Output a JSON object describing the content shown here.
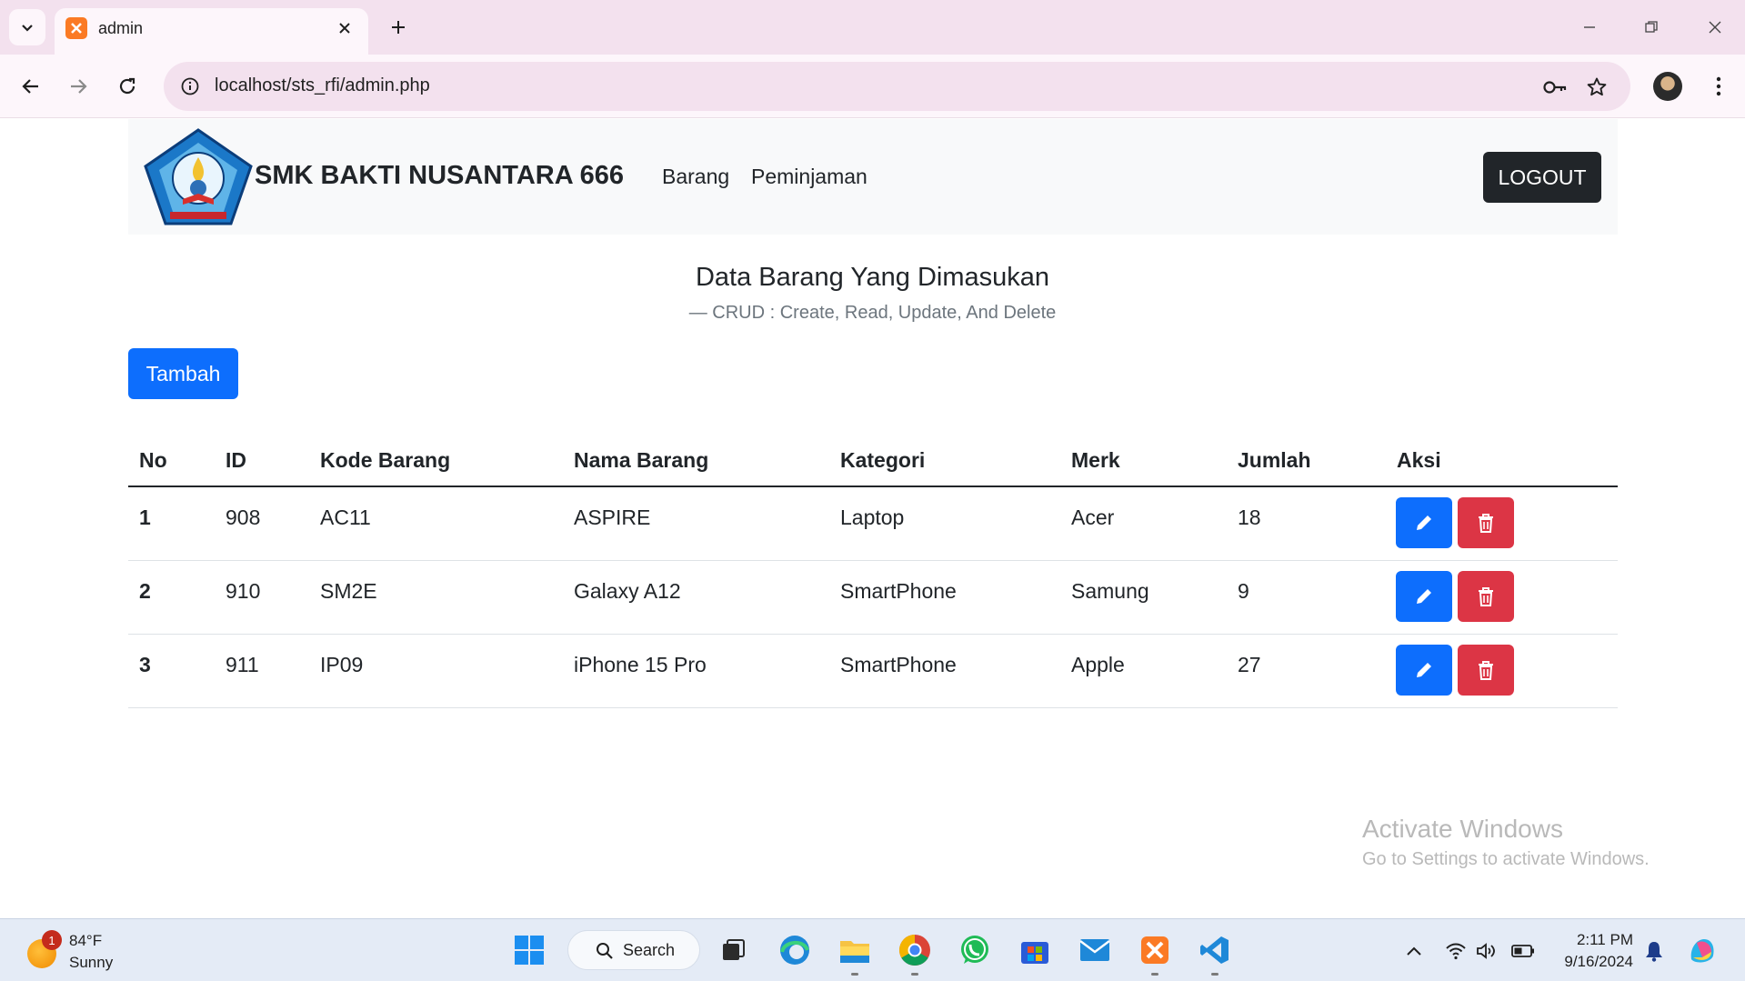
{
  "browser": {
    "tab_title": "admin",
    "url": "localhost/sts_rfi/admin.php"
  },
  "navbar": {
    "brand": "SMK BAKTI NUSANTARA 666",
    "links": [
      "Barang",
      "Peminjaman"
    ],
    "logout_label": "LOGOUT"
  },
  "content": {
    "title": "Data Barang Yang Dimasukan",
    "subtitle": "— CRUD : Create, Read, Update, And Delete",
    "add_button": "Tambah"
  },
  "table": {
    "headers": [
      "No",
      "ID",
      "Kode Barang",
      "Nama Barang",
      "Kategori",
      "Merk",
      "Jumlah",
      "Aksi"
    ],
    "rows": [
      [
        "1",
        "908",
        "AC11",
        "ASPIRE",
        "Laptop",
        "Acer",
        "18"
      ],
      [
        "2",
        "910",
        "SM2E",
        "Galaxy A12",
        "SmartPhone",
        "Samung",
        "9"
      ],
      [
        "3",
        "911",
        "IP09",
        "iPhone 15 Pro",
        "SmartPhone",
        "Apple",
        "27"
      ]
    ]
  },
  "watermark": {
    "line1": "Activate Windows",
    "line2": "Go to Settings to activate Windows."
  },
  "taskbar": {
    "weather_badge": "1",
    "temperature": "84°F",
    "condition": "Sunny",
    "search_label": "Search",
    "time": "2:11 PM",
    "date": "9/16/2024",
    "apps": [
      "start-icon",
      "task-view-icon",
      "edge-icon",
      "file-explorer-icon",
      "chrome-icon",
      "whatsapp-icon",
      "store-icon",
      "mail-icon",
      "xampp-icon",
      "vscode-icon"
    ]
  },
  "colors": {
    "primary": "#0d6efd",
    "danger": "#dc3545",
    "dark": "#212529",
    "tab_strip": "#f3e1ee"
  }
}
